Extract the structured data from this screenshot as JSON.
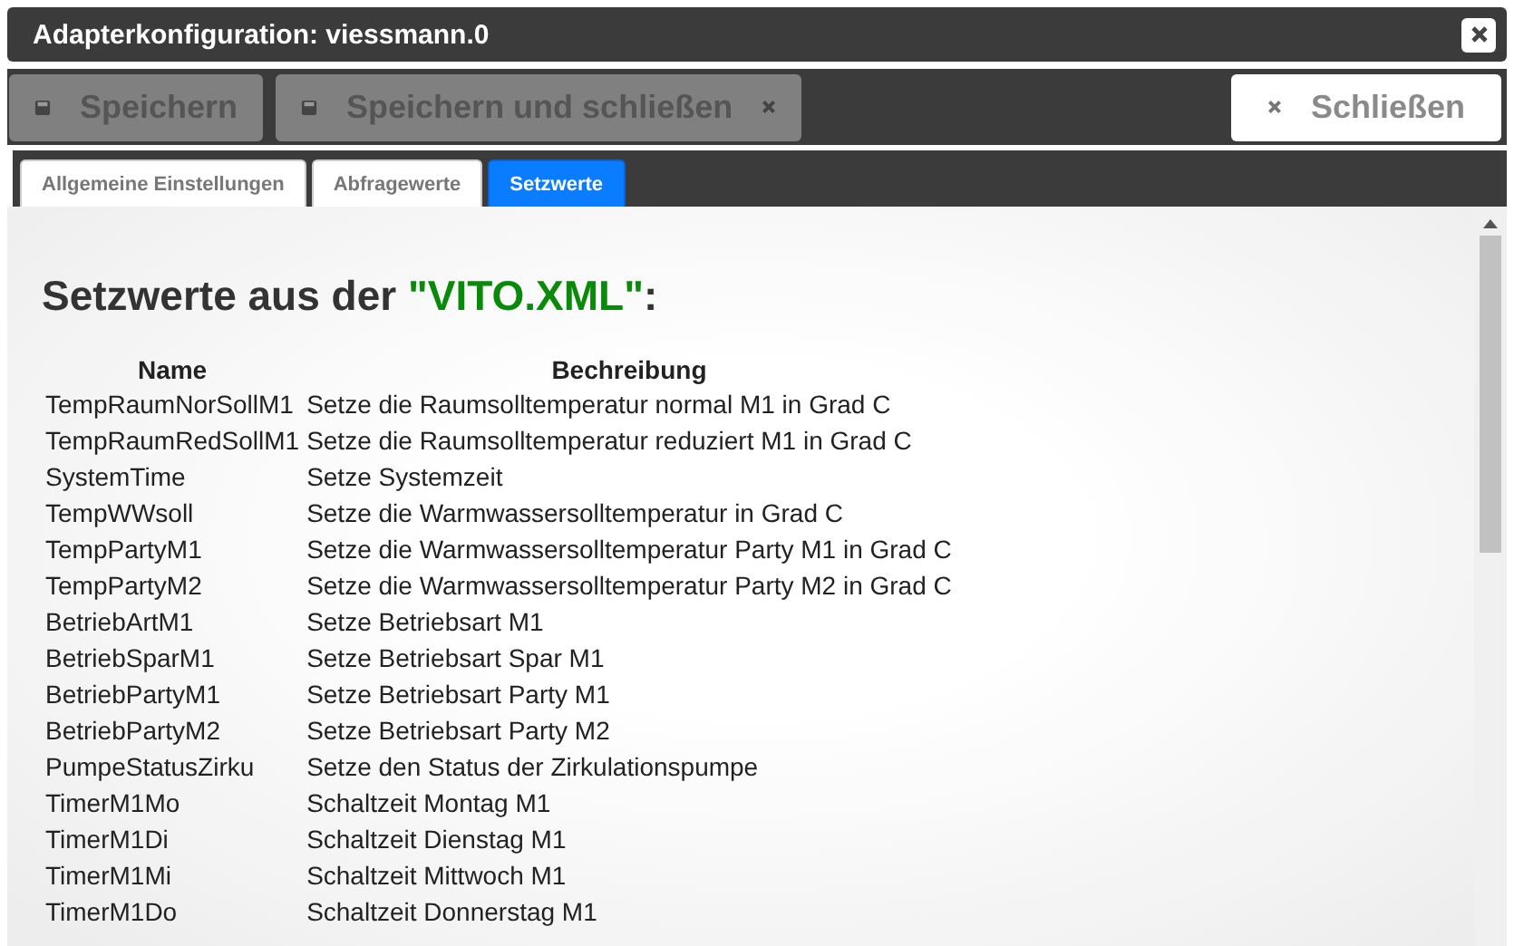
{
  "window": {
    "title": "Adapterkonfiguration: viessmann.0"
  },
  "buttons": [
    {
      "kind": "save",
      "label": "Speichern",
      "disabled": true
    },
    {
      "kind": "save_close",
      "label": "Speichern und schließen",
      "disabled": true
    },
    {
      "kind": "close",
      "label": "Schließen",
      "disabled": false
    }
  ],
  "tabs": [
    {
      "label": "Allgemeine Einstellungen",
      "selected": false
    },
    {
      "label": "Abfragewerte",
      "selected": false
    },
    {
      "label": "Setzwerte",
      "selected": true
    }
  ],
  "heading": {
    "text": "Setzwerte aus der ",
    "highlight": "\"VITO.XML\"",
    "suffix": ":"
  },
  "table": {
    "columns": [
      "Name",
      "Bechreibung"
    ],
    "rows": [
      [
        "TempRaumNorSollM1",
        "Setze die Raumsolltemperatur normal M1 in Grad C"
      ],
      [
        "TempRaumRedSollM1",
        "Setze die Raumsolltemperatur reduziert M1 in Grad C"
      ],
      [
        "SystemTime",
        "Setze Systemzeit"
      ],
      [
        "TempWWsoll",
        "Setze die Warmwassersolltemperatur in Grad C"
      ],
      [
        "TempPartyM1",
        "Setze die Warmwassersolltemperatur Party M1 in Grad C"
      ],
      [
        "TempPartyM2",
        "Setze die Warmwassersolltemperatur Party M2 in Grad C"
      ],
      [
        "BetriebArtM1",
        "Setze Betriebsart M1"
      ],
      [
        "BetriebSparM1",
        "Setze Betriebsart Spar M1"
      ],
      [
        "BetriebPartyM1",
        "Setze Betriebsart Party M1"
      ],
      [
        "BetriebPartyM2",
        "Setze Betriebsart Party M2"
      ],
      [
        "PumpeStatusZirku",
        "Setze den Status der Zirkulationspumpe"
      ],
      [
        "TimerM1Mo",
        "Schaltzeit Montag M1"
      ],
      [
        "TimerM1Di",
        "Schaltzeit Dienstag M1"
      ],
      [
        "TimerM1Mi",
        "Schaltzeit Mittwoch M1"
      ],
      [
        "TimerM1Do",
        "Schaltzeit Donnerstag M1"
      ]
    ]
  }
}
